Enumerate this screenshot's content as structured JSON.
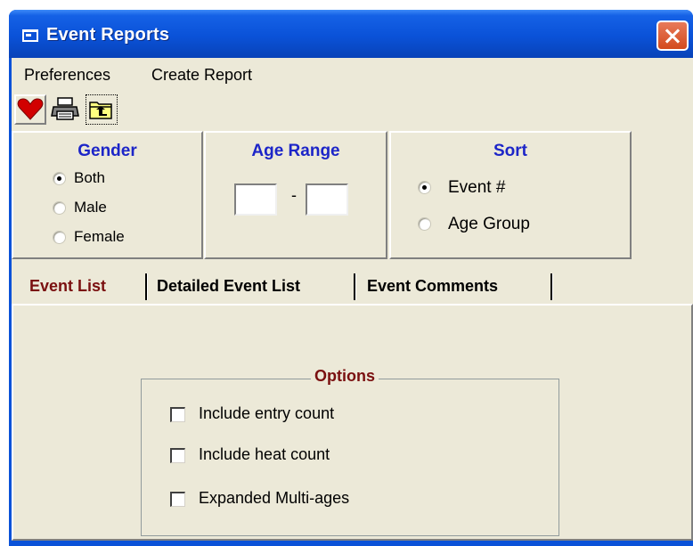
{
  "window": {
    "title": "Event Reports"
  },
  "menu": {
    "items": [
      "Preferences",
      "Create Report"
    ]
  },
  "toolbar": {
    "buttons": [
      "heart-icon",
      "printer-icon",
      "folder-up-icon"
    ]
  },
  "gender": {
    "title": "Gender",
    "options": [
      "Both",
      "Male",
      "Female"
    ],
    "selected": "Both"
  },
  "age_range": {
    "title": "Age Range",
    "separator": "-",
    "from": "",
    "to": ""
  },
  "sort": {
    "title": "Sort",
    "options": [
      "Event #",
      "Age Group"
    ],
    "selected": "Event #"
  },
  "tabs": [
    "Event List",
    "Detailed Event List",
    "Event Comments"
  ],
  "active_tab": "Event List",
  "options": {
    "legend": "Options",
    "checkboxes": [
      "Include entry count",
      "Include heat count",
      "Expanded Multi-ages"
    ]
  },
  "colors": {
    "titlebar": "#0a52d8",
    "panel_title": "#1c25c8",
    "accent_red": "#7a1010",
    "face": "#ece9d8"
  }
}
